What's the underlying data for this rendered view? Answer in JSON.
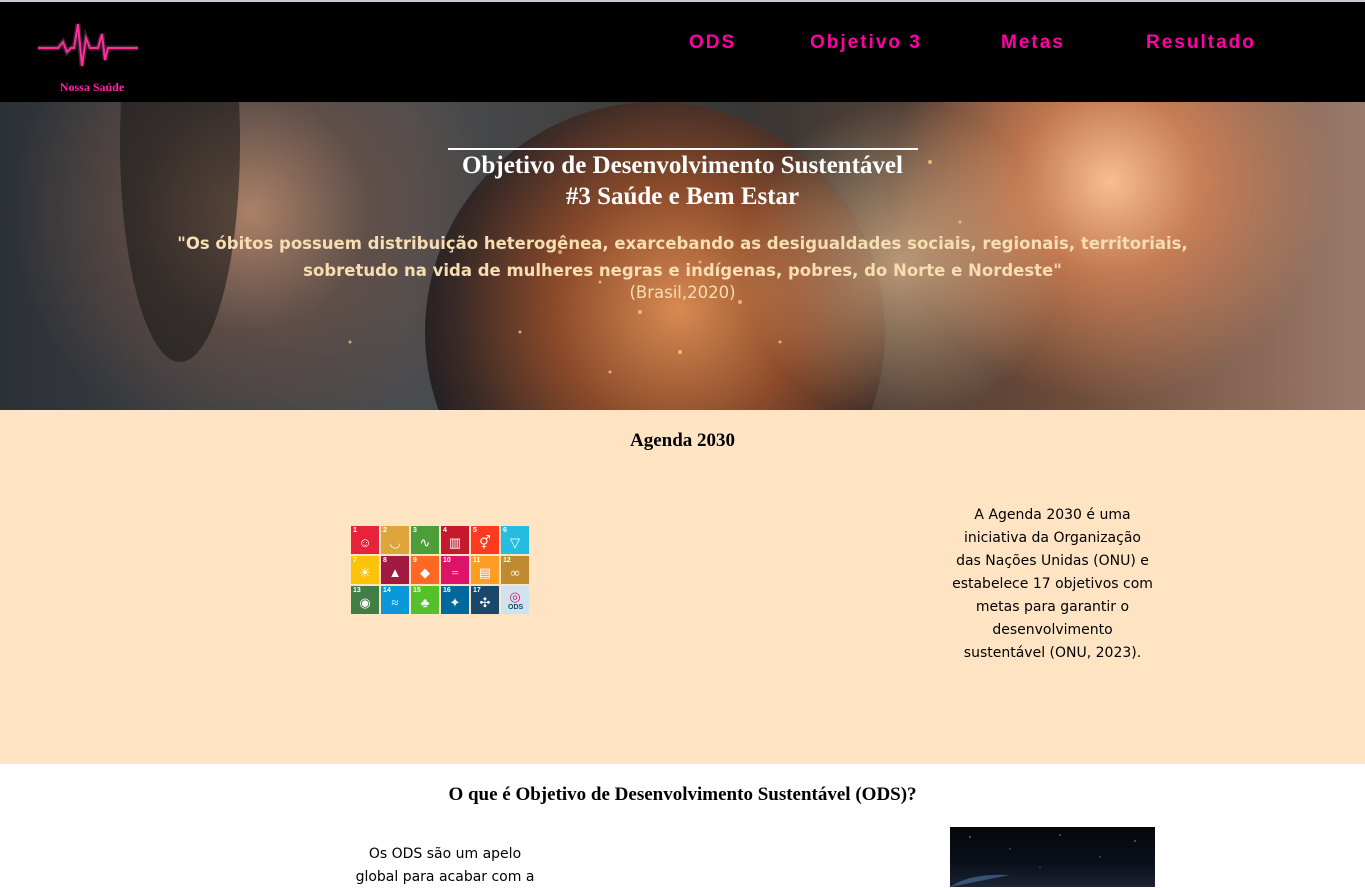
{
  "brand": {
    "name": "Nossa Saúde",
    "accent": "#ff00a8"
  },
  "nav": {
    "items": [
      {
        "label": "ODS"
      },
      {
        "label": "Objetivo 3"
      },
      {
        "label": "Metas"
      },
      {
        "label": "Resultado"
      }
    ]
  },
  "hero": {
    "title_line1": "Objetivo de Desenvolvimento Sustentável",
    "title_line2": "#3 Saúde e Bem Estar",
    "quote_line1": "\"Os óbitos possuem distribuição heterogênea, exarcebando as desigualdades sociais, regionais, territoriais,",
    "quote_line2": "sobretudo na vida de mulheres negras e indígenas, pobres, do Norte e Nordeste\"",
    "source": "(Brasil,2020)"
  },
  "agenda": {
    "title": "Agenda 2030",
    "background": "#fee4c3",
    "text": "A Agenda 2030 é uma iniciativa da Organização das Nações Unidas (ONU) e estabelece 17 objetivos com metas para garantir o desenvolvimento sustentável (ONU, 2023).",
    "sdg_tiles": [
      {
        "n": "1",
        "color": "#e5243b",
        "icon": "people-icon"
      },
      {
        "n": "2",
        "color": "#dda63a",
        "icon": "bowl-icon"
      },
      {
        "n": "3",
        "color": "#4c9f38",
        "icon": "heartbeat-icon"
      },
      {
        "n": "4",
        "color": "#c5192d",
        "icon": "book-icon"
      },
      {
        "n": "5",
        "color": "#ff3a21",
        "icon": "gender-icon"
      },
      {
        "n": "6",
        "color": "#26bde2",
        "icon": "water-icon"
      },
      {
        "n": "7",
        "color": "#fcc30b",
        "icon": "sun-icon"
      },
      {
        "n": "8",
        "color": "#a21942",
        "icon": "growth-icon"
      },
      {
        "n": "9",
        "color": "#fd6925",
        "icon": "industry-icon"
      },
      {
        "n": "10",
        "color": "#dd1367",
        "icon": "equality-icon"
      },
      {
        "n": "11",
        "color": "#fd9d24",
        "icon": "city-icon"
      },
      {
        "n": "12",
        "color": "#bf8b2e",
        "icon": "infinity-icon"
      },
      {
        "n": "13",
        "color": "#3f7e44",
        "icon": "eye-icon"
      },
      {
        "n": "14",
        "color": "#0a97d9",
        "icon": "fish-icon"
      },
      {
        "n": "15",
        "color": "#56c02b",
        "icon": "tree-icon"
      },
      {
        "n": "16",
        "color": "#00689d",
        "icon": "dove-icon"
      },
      {
        "n": "17",
        "color": "#19486a",
        "icon": "partnership-icon"
      },
      {
        "n": "ODS",
        "color": "#cfe3ef",
        "icon": "sdg-wheel-icon"
      }
    ]
  },
  "ods": {
    "title": "O que é Objetivo de Desenvolvimento Sustentável (ODS)?",
    "text_line1": "Os ODS são um apelo",
    "text_line2": "global para acabar com a"
  }
}
